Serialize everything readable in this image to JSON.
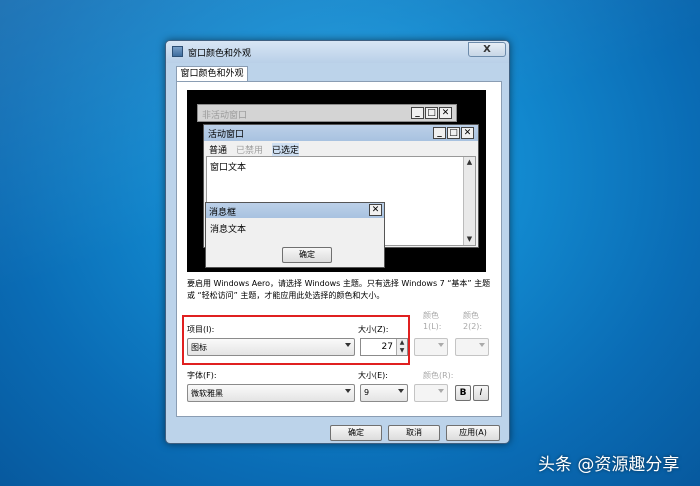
{
  "window": {
    "title": "窗口颜色和外观",
    "tab_label": "窗口颜色和外观",
    "close_glyph": "X"
  },
  "preview": {
    "inactive_title": "非活动窗口",
    "active_title": "活动窗口",
    "menu": {
      "normal": "普通",
      "disabled": "已禁用",
      "selected": "已选定"
    },
    "window_text": "窗口文本",
    "msgbox_title": "消息框",
    "msgbox_text": "消息文本",
    "msgbox_ok": "确定"
  },
  "description": "要启用 Windows Aero，请选择 Windows 主题。只有选择 Windows 7 “基本” 主题或 “轻松访问” 主题，才能应用此处选择的颜色和大小。",
  "item": {
    "label": "项目(I):",
    "value": "图标",
    "size_label": "大小(Z):",
    "size_value": "27",
    "color1_label": "颜色 1(L):",
    "color2_label": "颜色 2(2):"
  },
  "font": {
    "label": "字体(F):",
    "value": "微软雅黑",
    "size_label": "大小(E):",
    "size_value": "9",
    "color_label": "颜色(R):",
    "bold": "B",
    "italic": "I"
  },
  "buttons": {
    "ok": "确定",
    "cancel": "取消",
    "apply": "应用(A)"
  },
  "watermark": "头条 @资源趣分享",
  "colors": {
    "highlight_box": "#e02020",
    "desktop": "#1289cf"
  }
}
